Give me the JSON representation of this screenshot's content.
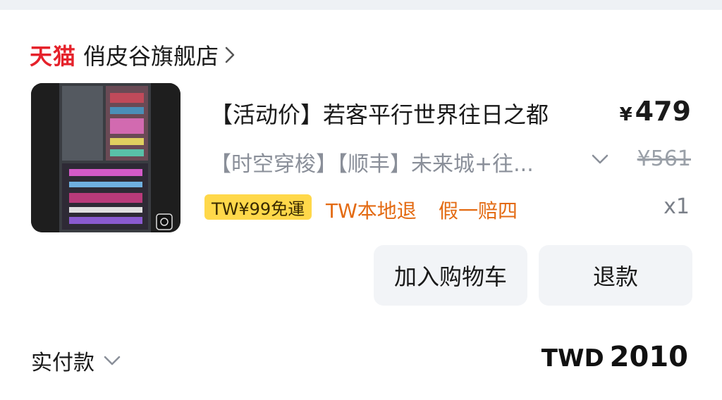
{
  "store": {
    "brand": "天猫",
    "name": "俏皮谷旗舰店"
  },
  "product": {
    "title": "【活动价】若客平行世界往日之都",
    "price_currency": "¥",
    "price": "479",
    "variant": "【时空穿梭】【顺丰】未来城+往...",
    "original_price": "¥561",
    "shipping_badge": "TW¥99免運",
    "tag_return": "TW本地退",
    "tag_guarantee": "假一赔四",
    "quantity": "x1"
  },
  "actions": {
    "add_to_cart": "加入购物车",
    "refund": "退款"
  },
  "payment": {
    "label": "实付款",
    "currency": "TWD",
    "amount": "2010"
  },
  "icons": {
    "store_chevron": "chevron-right-icon",
    "variant_dropdown": "chevron-down-icon",
    "payment_dropdown": "chevron-down-icon"
  },
  "colors": {
    "brand_red": "#e5222b",
    "tag_orange": "#e36a12",
    "badge_yellow": "#ffd84a",
    "button_bg": "#f2f4f7"
  }
}
